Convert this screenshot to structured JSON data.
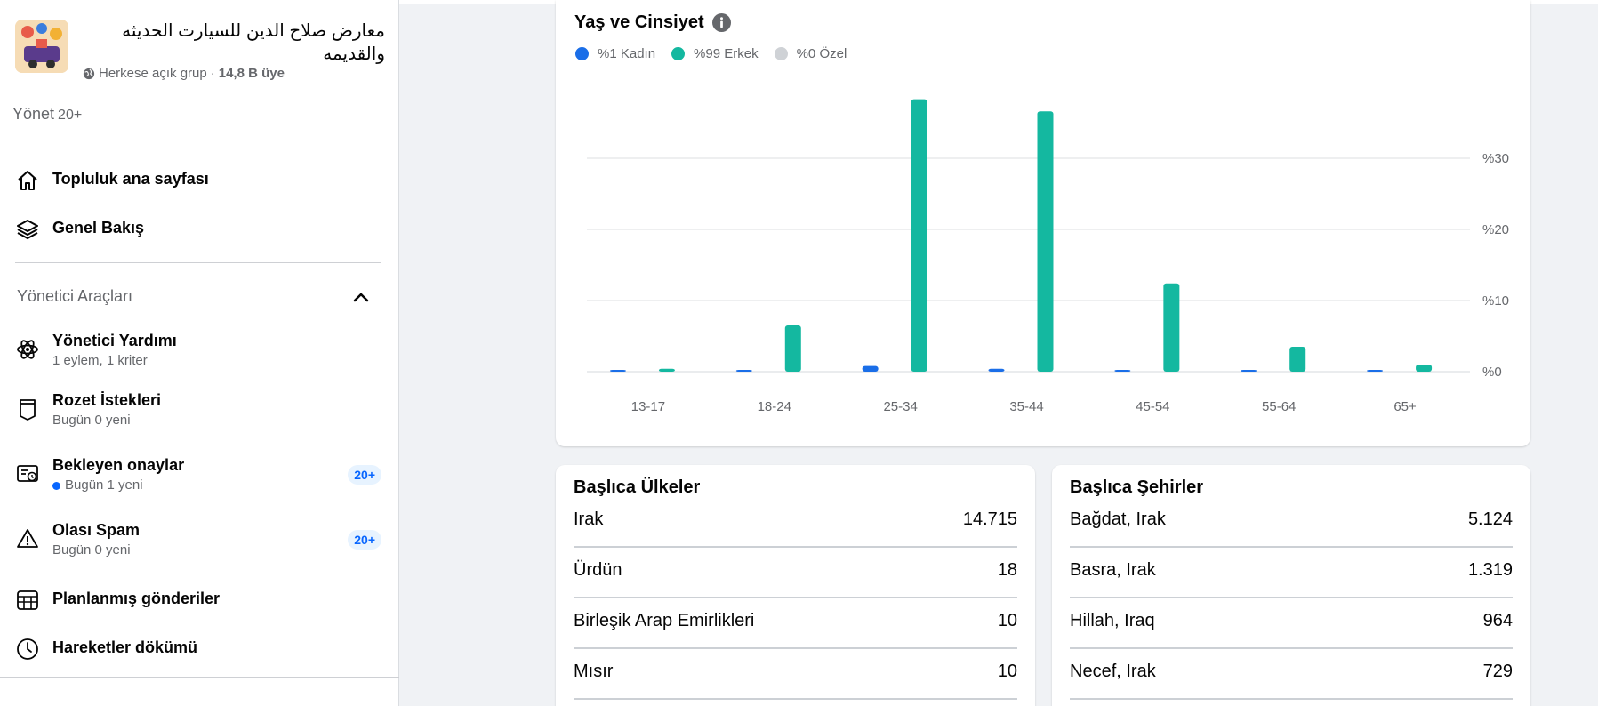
{
  "group": {
    "name": "معارض صلاح الدين للسيارت الحديثه والقديمه",
    "privacy": "Herkese açık grup",
    "separator": " · ",
    "members": "14,8 B üye"
  },
  "manage": {
    "label": "Yönet",
    "count": "20+"
  },
  "nav": {
    "community_home": "Topluluk ana sayfası",
    "overview": "Genel Bakış"
  },
  "admin_tools": {
    "title": "Yönetici Araçları",
    "items": [
      {
        "title": "Yönetici Yardımı",
        "sub": "1 eylem, 1 kriter"
      },
      {
        "title": "Rozet İstekleri",
        "sub": "Bugün 0 yeni"
      },
      {
        "title": "Bekleyen onaylar",
        "sub": "Bugün 1 yeni",
        "badge": "20+"
      },
      {
        "title": "Olası Spam",
        "sub": "Bugün 0 yeni",
        "badge": "20+"
      },
      {
        "title": "Planlanmış gönderiler"
      },
      {
        "title": "Hareketler dökümü"
      }
    ]
  },
  "chart_data": {
    "type": "bar",
    "title": "Yaş ve Cinsiyet",
    "categories": [
      "13-17",
      "18-24",
      "25-34",
      "35-44",
      "45-54",
      "55-64",
      "65+"
    ],
    "series": [
      {
        "name": "%1 Kadın",
        "color": "#1a6ee8",
        "values": [
          0.05,
          0.2,
          0.8,
          0.4,
          0.15,
          0.05,
          0.02
        ]
      },
      {
        "name": "%99 Erkek",
        "color": "#14b8a0",
        "values": [
          0.4,
          6.5,
          38.3,
          36.6,
          12.4,
          3.5,
          1.0
        ]
      },
      {
        "name": "%0 Özel",
        "color": "#cfd2d6",
        "values": [
          0,
          0,
          0,
          0,
          0,
          0,
          0
        ]
      }
    ],
    "y_ticks": [
      "%0",
      "%10",
      "%20",
      "%30"
    ],
    "ylim": [
      0,
      40
    ],
    "grid": true,
    "legend": "top-left"
  },
  "countries": {
    "title": "Başlıca Ülkeler",
    "rows": [
      {
        "name": "Irak",
        "value": "14.715"
      },
      {
        "name": "Ürdün",
        "value": "18"
      },
      {
        "name": "Birleşik Arap Emirlikleri",
        "value": "10"
      },
      {
        "name": "Mısır",
        "value": "10"
      }
    ]
  },
  "cities": {
    "title": "Başlıca Şehirler",
    "rows": [
      {
        "name": "Bağdat, Irak",
        "value": "5.124"
      },
      {
        "name": "Basra, Irak",
        "value": "1.319"
      },
      {
        "name": "Hillah, Iraq",
        "value": "964"
      },
      {
        "name": "Necef, Irak",
        "value": "729"
      }
    ]
  }
}
